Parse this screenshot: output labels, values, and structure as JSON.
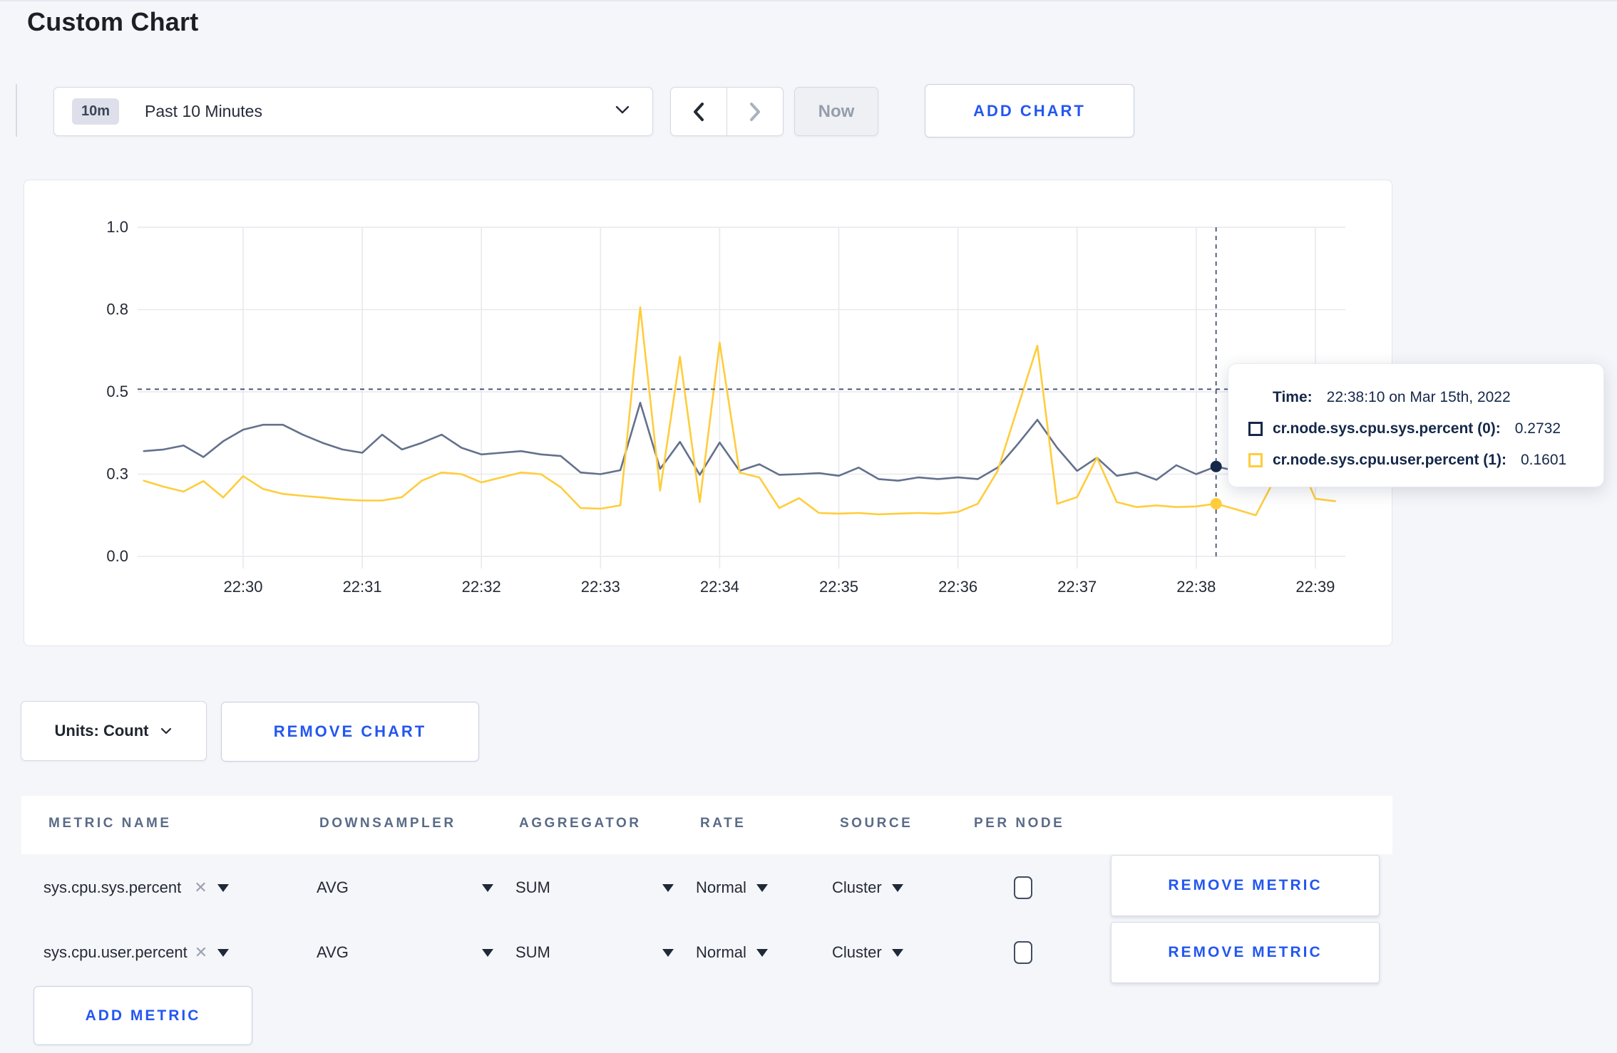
{
  "page": {
    "title": "Custom Chart"
  },
  "toolbar": {
    "time_range": {
      "badge": "10m",
      "label": "Past 10 Minutes"
    },
    "now_label": "Now",
    "add_chart_label": "ADD CHART"
  },
  "colors": {
    "accent_blue": "#2457f0",
    "series_sys_line": "#64718c",
    "series_sys_marker": "#152849",
    "series_user_line": "#ffcd3c",
    "grid": "#e9e9ee",
    "crosshair": "#42526e"
  },
  "chart_data": {
    "type": "line",
    "title": "",
    "xlabel": "",
    "ylabel": "",
    "ylim": [
      0,
      1
    ],
    "grid": true,
    "legend_position": "tooltip",
    "x_start": "22:29:10",
    "x_interval_seconds": 10,
    "x_tick_labels": [
      "22:30",
      "22:31",
      "22:32",
      "22:33",
      "22:34",
      "22:35",
      "22:36",
      "22:37",
      "22:38",
      "22:39"
    ],
    "y_ticks": [
      {
        "value": 0.0,
        "label": "0.0"
      },
      {
        "value": 0.25,
        "label": "0.3"
      },
      {
        "value": 0.5,
        "label": "0.5"
      },
      {
        "value": 0.75,
        "label": "0.8"
      },
      {
        "value": 1.0,
        "label": "1.0"
      }
    ],
    "series": [
      {
        "name": "cr.node.sys.cpu.sys.percent",
        "color": "#64718c",
        "marker_color": "#152849",
        "values": [
          0.32,
          0.325,
          0.337,
          0.302,
          0.35,
          0.385,
          0.4,
          0.4,
          0.37,
          0.345,
          0.325,
          0.315,
          0.37,
          0.325,
          0.345,
          0.37,
          0.33,
          0.31,
          0.315,
          0.32,
          0.31,
          0.305,
          0.255,
          0.25,
          0.262,
          0.467,
          0.266,
          0.348,
          0.248,
          0.346,
          0.26,
          0.28,
          0.248,
          0.25,
          0.253,
          0.245,
          0.27,
          0.235,
          0.23,
          0.24,
          0.235,
          0.24,
          0.235,
          0.27,
          0.34,
          0.415,
          0.33,
          0.26,
          0.3,
          0.245,
          0.255,
          0.233,
          0.277,
          0.25,
          0.2732,
          0.26,
          0.262,
          0.26,
          0.258,
          0.26,
          0.262
        ]
      },
      {
        "name": "cr.node.sys.cpu.user.percent",
        "color": "#ffcd3c",
        "marker_color": "#ffcd3c",
        "values": [
          0.23,
          0.212,
          0.197,
          0.229,
          0.179,
          0.244,
          0.205,
          0.19,
          0.184,
          0.179,
          0.173,
          0.17,
          0.17,
          0.18,
          0.23,
          0.255,
          0.25,
          0.225,
          0.24,
          0.255,
          0.25,
          0.21,
          0.147,
          0.145,
          0.155,
          0.757,
          0.2,
          0.607,
          0.165,
          0.65,
          0.255,
          0.24,
          0.147,
          0.177,
          0.132,
          0.13,
          0.132,
          0.128,
          0.13,
          0.132,
          0.13,
          0.135,
          0.16,
          0.26,
          0.45,
          0.64,
          0.16,
          0.18,
          0.3,
          0.165,
          0.15,
          0.155,
          0.15,
          0.152,
          0.1601,
          0.143,
          0.125,
          0.24,
          0.315,
          0.175,
          0.168
        ]
      }
    ],
    "crosshair": {
      "time": "22:38:10",
      "hline_value": 0.508
    }
  },
  "tooltip": {
    "time_label": "Time:",
    "time_value": "22:38:10 on Mar 15th, 2022",
    "series": [
      {
        "name": "cr.node.sys.cpu.sys.percent (0):",
        "value": "0.2732",
        "color": "#152849"
      },
      {
        "name": "cr.node.sys.cpu.user.percent (1):",
        "value": "0.1601",
        "color": "#ffcd3c"
      }
    ]
  },
  "controls": {
    "units_label": "Units: Count",
    "remove_chart_label": "REMOVE CHART",
    "remove_metric_label": "REMOVE METRIC",
    "add_metric_label": "ADD METRIC"
  },
  "metrics_table": {
    "headers": [
      "METRIC NAME",
      "DOWNSAMPLER",
      "AGGREGATOR",
      "RATE",
      "SOURCE",
      "PER NODE"
    ],
    "rows": [
      {
        "metric": "sys.cpu.sys.percent",
        "downsampler": "AVG",
        "aggregator": "SUM",
        "rate": "Normal",
        "source": "Cluster",
        "per_node_checked": false
      },
      {
        "metric": "sys.cpu.user.percent",
        "downsampler": "AVG",
        "aggregator": "SUM",
        "rate": "Normal",
        "source": "Cluster",
        "per_node_checked": false
      }
    ]
  }
}
